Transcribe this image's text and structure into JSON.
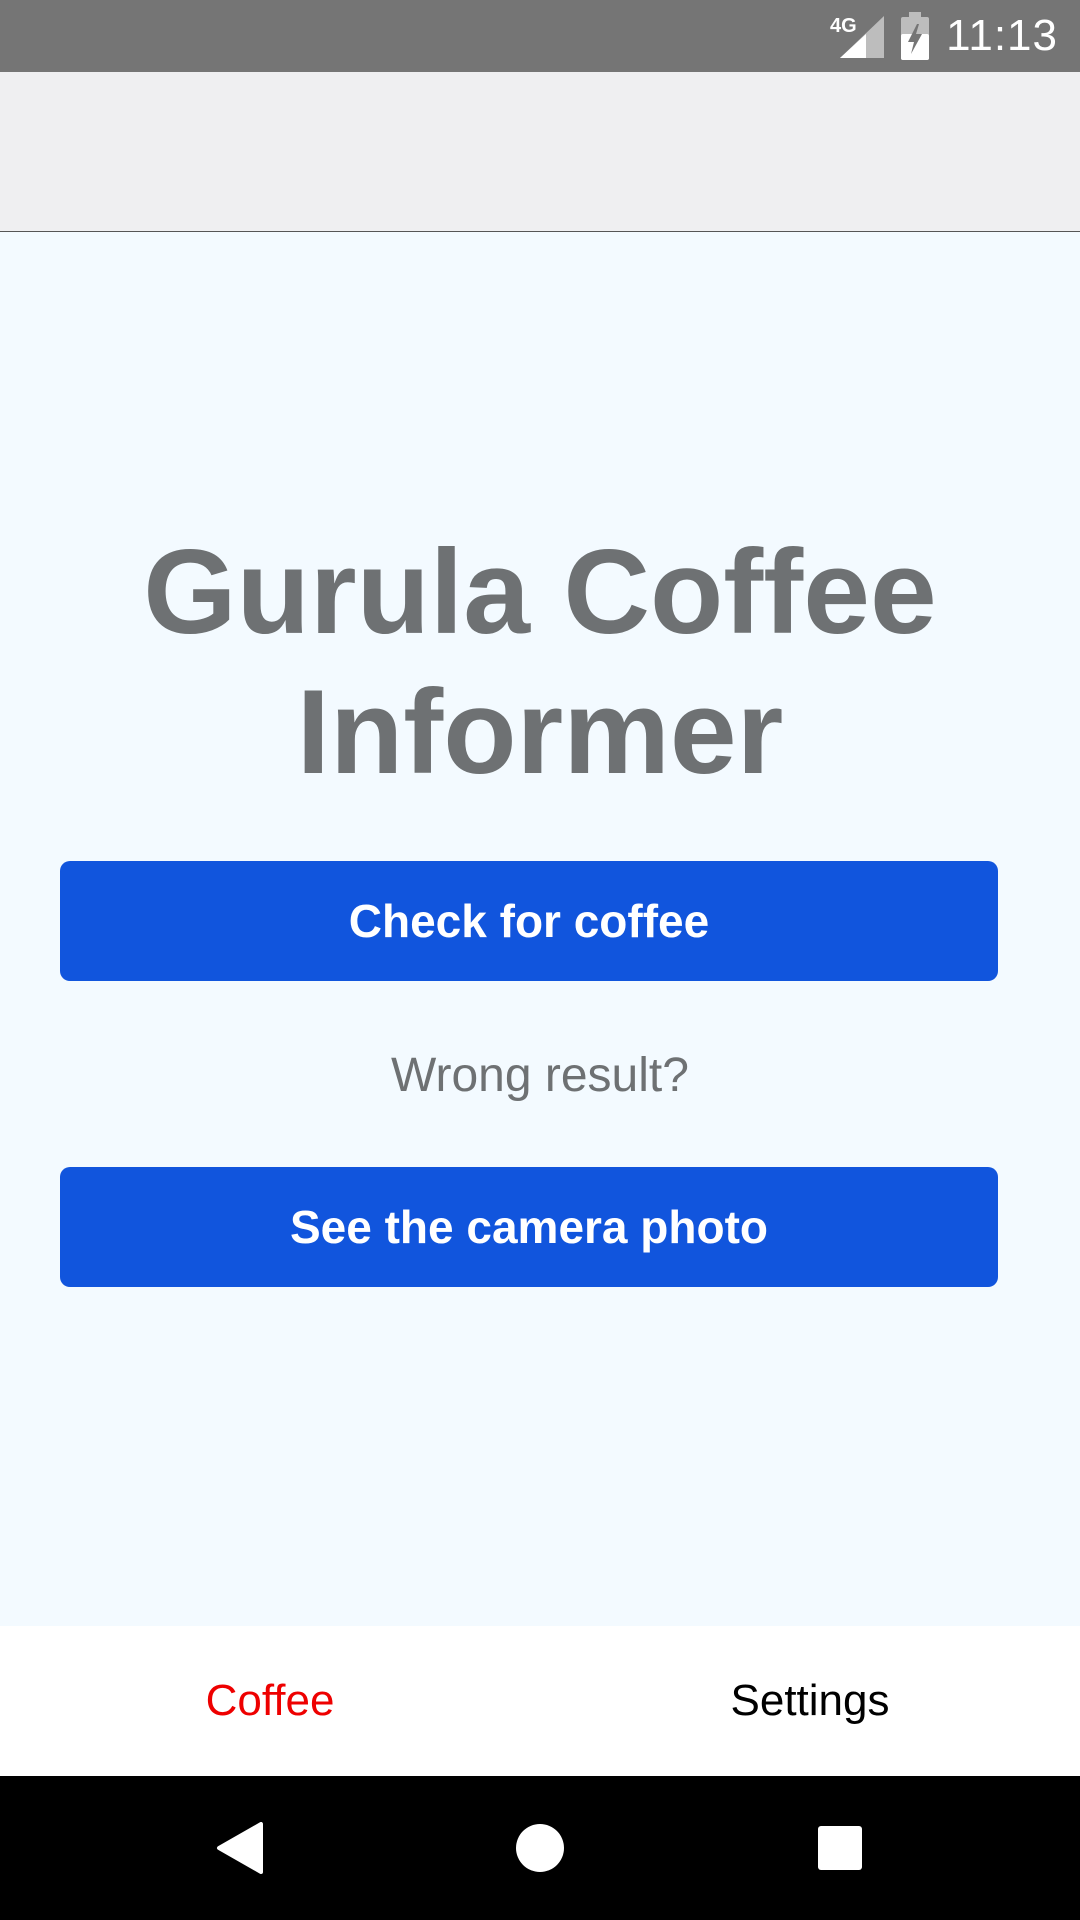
{
  "status_bar": {
    "network_label": "4G",
    "time": "11:13",
    "icons": [
      "network-signal-icon",
      "battery-charging-icon"
    ]
  },
  "main": {
    "title": "Gurula Coffee Informer",
    "check_button_label": "Check for coffee",
    "wrong_result_label": "Wrong result?",
    "photo_button_label": "See the camera photo"
  },
  "tabs": [
    {
      "label": "Coffee",
      "active": true
    },
    {
      "label": "Settings",
      "active": false
    }
  ],
  "nav_bar": {
    "icons": [
      "back-icon",
      "home-icon",
      "recents-icon"
    ]
  },
  "colors": {
    "status_bar": "#757575",
    "header": "#efeff1",
    "main_background": "#f3faff",
    "title_text": "#6e7173",
    "button": "#1155dd",
    "active_tab": "#ee0000",
    "inactive_tab": "#000000",
    "nav_bar": "#000000"
  }
}
